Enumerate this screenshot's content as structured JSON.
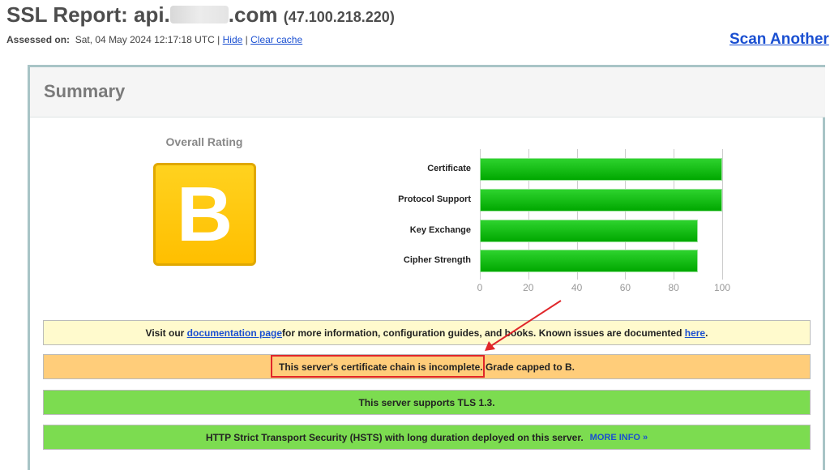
{
  "header": {
    "title_prefix": "SSL Report: api.",
    "title_suffix": ".com",
    "ip": "(47.100.218.220)",
    "assessed_label": "Assessed on:",
    "assessed_value": "Sat, 04 May 2024 12:17:18 UTC",
    "sep": "|",
    "hide": "Hide",
    "clear_cache": "Clear cache",
    "scan_another": "Scan Another"
  },
  "summary": {
    "title": "Summary",
    "overall_rating_label": "Overall Rating",
    "grade": "B"
  },
  "chart_data": {
    "type": "bar",
    "orientation": "horizontal",
    "categories": [
      "Certificate",
      "Protocol Support",
      "Key Exchange",
      "Cipher Strength"
    ],
    "values": [
      100,
      100,
      90,
      90
    ],
    "xlim": [
      0,
      100
    ],
    "ticks": [
      "0",
      "20",
      "40",
      "60",
      "80",
      "100"
    ],
    "bar_color": "#00b000"
  },
  "notices": {
    "doc": {
      "pre": "Visit our ",
      "link": "documentation page",
      "mid": " for more information, configuration guides, and books. Known issues are documented ",
      "link2": "here",
      "post": "."
    },
    "chain": {
      "highlight": "This server's certificate chain is incomplete.",
      "rest": " Grade capped to B."
    },
    "tls": "This server supports TLS 1.3.",
    "hsts": {
      "text": "HTTP Strict Transport Security (HSTS) with long duration deployed on this server.",
      "more": "MORE INFO »"
    }
  },
  "colors": {
    "annotation": "#e0262a",
    "warning": "#ffcd7a",
    "good": "#7cdc50",
    "info": "#fffacd"
  }
}
